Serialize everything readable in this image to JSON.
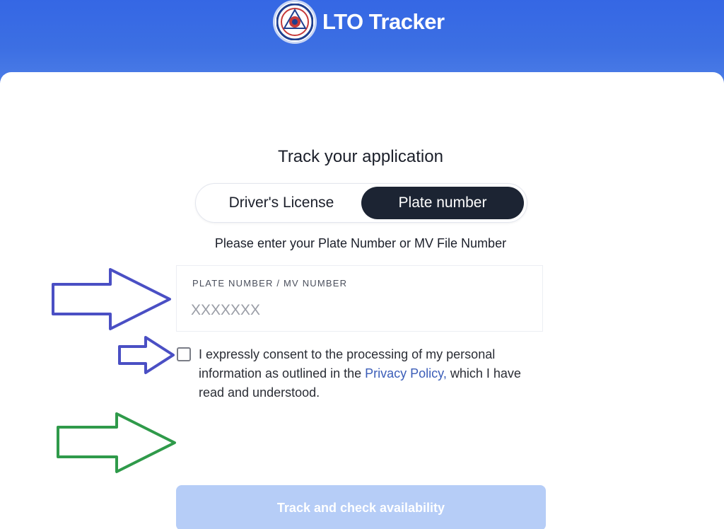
{
  "header": {
    "brand": "LTO Tracker",
    "logo_icon": "lto-seal-icon"
  },
  "main": {
    "title": "Track your application",
    "tabs": [
      {
        "label": "Driver's License",
        "active": false
      },
      {
        "label": "Plate number",
        "active": true
      }
    ],
    "instruction": "Please enter your Plate Number or MV File Number",
    "field": {
      "label": "PLATE NUMBER / MV NUMBER",
      "placeholder": "XXXXXXX",
      "value": ""
    },
    "consent": {
      "checked": false,
      "text_before": "I expressly consent to the processing of my personal information as outlined in the ",
      "link": "Privacy Policy,",
      "text_after": " which I have read and understood."
    },
    "submit_label": "Track and check availability",
    "submit_enabled": false
  },
  "annotations": [
    {
      "icon": "arrow-right-icon",
      "color": "#4a4fc4",
      "target": "plate-number-field"
    },
    {
      "icon": "arrow-right-icon",
      "color": "#4a4fc4",
      "target": "consent-checkbox"
    },
    {
      "icon": "arrow-right-icon",
      "color": "#2f9a4a",
      "target": "track-button"
    }
  ],
  "colors": {
    "header": "#3567e4",
    "active_tab": "#1c2433",
    "button_disabled": "#b6cdf7",
    "link": "#3b5db8"
  }
}
